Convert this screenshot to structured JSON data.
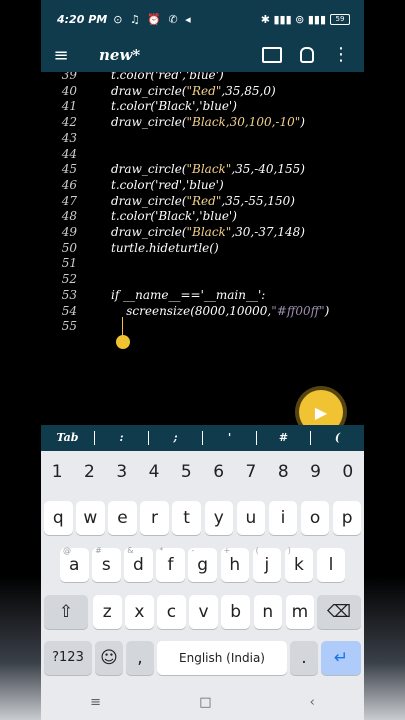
{
  "status": {
    "time": "4:20 PM",
    "left_icons": "⊙ ♫ ⏰ ✆ ◂",
    "right_icons": "✱ ▮▮▮ ⊚ ▮▮▮",
    "battery": "59"
  },
  "appbar": {
    "title": "new*"
  },
  "editor": {
    "lines": [
      {
        "n": "39",
        "parts": [
          {
            "t": "t.color('red','blue')",
            "c": "code"
          }
        ]
      },
      {
        "n": "40",
        "parts": [
          {
            "t": "draw_circle(",
            "c": "code"
          },
          {
            "t": "\"Red\"",
            "c": "str"
          },
          {
            "t": ",35,85,0)",
            "c": "code"
          }
        ]
      },
      {
        "n": "41",
        "parts": [
          {
            "t": "t.color('Black','blue')",
            "c": "code"
          }
        ]
      },
      {
        "n": "42",
        "parts": [
          {
            "t": "draw_circle(",
            "c": "code"
          },
          {
            "t": "\"Black,30,100,-10\"",
            "c": "str"
          },
          {
            "t": ")",
            "c": "code"
          }
        ]
      },
      {
        "n": "43",
        "parts": []
      },
      {
        "n": "44",
        "parts": []
      },
      {
        "n": "45",
        "parts": [
          {
            "t": "draw_circle(",
            "c": "code"
          },
          {
            "t": "\"Black\"",
            "c": "str"
          },
          {
            "t": ",35,-40,155)",
            "c": "code"
          }
        ]
      },
      {
        "n": "46",
        "parts": [
          {
            "t": "t.color('red','blue')",
            "c": "code"
          }
        ]
      },
      {
        "n": "47",
        "parts": [
          {
            "t": "draw_circle(",
            "c": "code"
          },
          {
            "t": "\"Red\"",
            "c": "str"
          },
          {
            "t": ",35,-55,150)",
            "c": "code"
          }
        ]
      },
      {
        "n": "48",
        "parts": [
          {
            "t": "t.color('Black','blue')",
            "c": "code"
          }
        ]
      },
      {
        "n": "49",
        "parts": [
          {
            "t": "draw_circle(",
            "c": "code"
          },
          {
            "t": "\"Black\"",
            "c": "str"
          },
          {
            "t": ",30,-37,148)",
            "c": "code"
          }
        ]
      },
      {
        "n": "50",
        "parts": [
          {
            "t": "turtle.hideturtle()",
            "c": "code"
          }
        ]
      },
      {
        "n": "51",
        "parts": []
      },
      {
        "n": "52",
        "parts": []
      },
      {
        "n": "53",
        "parts": [
          {
            "t": "if __name__=='__main__':",
            "c": "code"
          }
        ]
      },
      {
        "n": "54",
        "parts": [
          {
            "t": "    screensize(8000,10000,",
            "c": "code"
          },
          {
            "t": "\"#ff00ff\"",
            "c": "str-faint"
          },
          {
            "t": ")",
            "c": "code"
          }
        ]
      },
      {
        "n": "55",
        "parts": []
      }
    ]
  },
  "symbols": [
    "Tab",
    ":",
    ";",
    "'",
    "#",
    "("
  ],
  "keyboard": {
    "numbers": [
      "1",
      "2",
      "3",
      "4",
      "5",
      "6",
      "7",
      "8",
      "9",
      "0"
    ],
    "row1": [
      "q",
      "w",
      "e",
      "r",
      "t",
      "y",
      "u",
      "i",
      "o",
      "p"
    ],
    "row2": [
      "a",
      "s",
      "d",
      "f",
      "g",
      "h",
      "j",
      "k",
      "l"
    ],
    "row2_hints": [
      "@",
      "#",
      "&",
      "*",
      "-",
      "+",
      "(",
      ")"
    ],
    "row3": [
      "z",
      "x",
      "c",
      "v",
      "b",
      "n",
      "m"
    ],
    "shift": "⇧",
    "backspace": "⌫",
    "sym_key": "?123",
    "emoji": "☺",
    "comma": ",",
    "space_label": "English (India)",
    "period": ".",
    "enter": "↵"
  },
  "navbar": {
    "recents": "≡",
    "home": "□",
    "back": "‹"
  },
  "colors": {
    "appbar": "#0f3b4d",
    "accent": "#f1c232",
    "string": "#f3d28b"
  }
}
